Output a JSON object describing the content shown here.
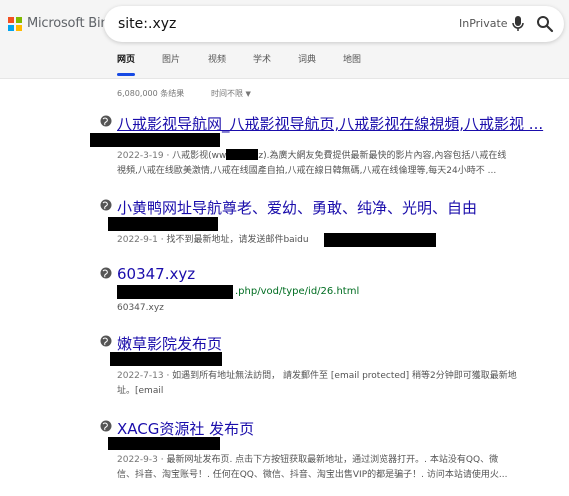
{
  "header": {
    "logo_text": "Microsoft Bing",
    "logo_colors": [
      "#f25022",
      "#7fba00",
      "#00a4ef",
      "#ffb900"
    ],
    "search_query": "site:.xyz",
    "inprivate_label": "InPrivate",
    "accent_color": "#174ae4"
  },
  "tabs": [
    {
      "label": "网页",
      "active": true
    },
    {
      "label": "图片",
      "active": false
    },
    {
      "label": "视频",
      "active": false
    },
    {
      "label": "学术",
      "active": false
    },
    {
      "label": "词典",
      "active": false
    },
    {
      "label": "地图",
      "active": false
    }
  ],
  "results_meta": {
    "count_text": "6,080,000 条结果",
    "filter_label": "时间不限"
  },
  "results": [
    {
      "title": "八戒影视导航网_八戒影视导航页,八戒影视在線視頻,八戒影视 ...",
      "date": "2022-3-19",
      "snippet_line1": "八戒影视(ww",
      "snippet_line1b": "z).為廣大網友免費提供最新最快的影片內容,內容包括八戒在线",
      "snippet_line2": "視頻,八戒在线歐美激情,八戒在线國產自拍,八戒在線日韓無碼,八戒在线倫理等,每天24小時不 ..."
    },
    {
      "title": "小黄鸭网址导航尊老、爱幼、勇敢、纯净、光明、自由",
      "date": "2022-9-1",
      "snippet_line1": "找不到最新地址，请发送邮件baidu"
    },
    {
      "title": "60347.xyz",
      "url_suffix": ".php/vod/type/id/26.html",
      "url_small": "60347.xyz"
    },
    {
      "title": "嫩草影院发布页",
      "date": "2022-7-13",
      "snippet_line1": "如遇到所有地址無法訪問， 請发郵件至 [email protected] 稍等2分钟即可獲取最新地",
      "snippet_line2": "址。[email"
    },
    {
      "title": "XACG资源社 发布页",
      "date": "2022-9-3",
      "snippet_line1": "最新网址发布页. 点击下方按钮获取最新地址，通过浏览器打开。. 本站没有QQ、微",
      "snippet_line2": "信、抖音、淘宝账号！. 任何在QQ、微信、抖音、淘宝出售VIP的都是骗子！. 访问本站请使用火..."
    }
  ]
}
